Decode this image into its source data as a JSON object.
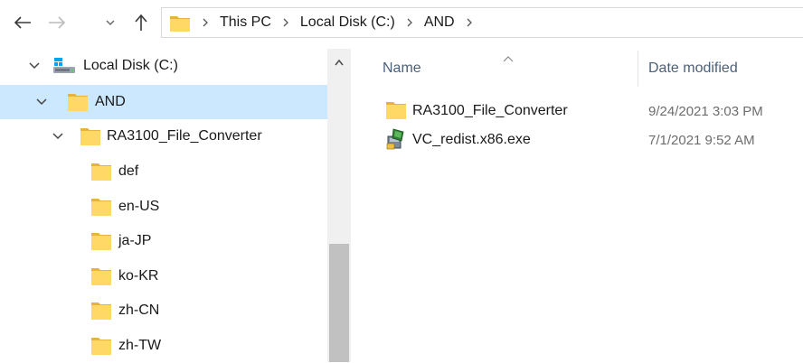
{
  "window": {
    "nav": {
      "back_icon": "arrow-left-icon",
      "forward_icon": "arrow-right-icon",
      "recent_icon": "chevron-down-icon",
      "up_icon": "arrow-up-icon"
    },
    "address": {
      "crumbs": [
        "This PC",
        "Local Disk (C:)",
        "AND"
      ]
    }
  },
  "nav_pane": {
    "items": [
      {
        "label": "Local Disk (C:)",
        "icon": "drive-icon",
        "expanded": true,
        "selected": false
      },
      {
        "label": "AND",
        "icon": "folder-icon",
        "expanded": true,
        "selected": true
      },
      {
        "label": "RA3100_File_Converter",
        "icon": "folder-icon",
        "expanded": true,
        "selected": false
      },
      {
        "label": "def",
        "icon": "folder-icon",
        "selected": false
      },
      {
        "label": "en-US",
        "icon": "folder-icon",
        "selected": false
      },
      {
        "label": "ja-JP",
        "icon": "folder-icon",
        "selected": false
      },
      {
        "label": "ko-KR",
        "icon": "folder-icon",
        "selected": false
      },
      {
        "label": "zh-CN",
        "icon": "folder-icon",
        "selected": false
      },
      {
        "label": "zh-TW",
        "icon": "folder-icon",
        "selected": false
      }
    ]
  },
  "file_list": {
    "columns": {
      "name": "Name",
      "date_modified": "Date modified"
    },
    "sort_column": "name",
    "rows": [
      {
        "name": "RA3100_File_Converter",
        "date": "9/24/2021 3:03 PM",
        "icon": "folder-icon"
      },
      {
        "name": "VC_redist.x86.exe",
        "date": "7/1/2021 9:52 AM",
        "icon": "installer-icon"
      }
    ]
  },
  "colors": {
    "selected_row": "#cce8ff",
    "folder_yellow": "#ffd866",
    "folder_dark": "#e6b43c",
    "header_text": "#4c607a"
  }
}
